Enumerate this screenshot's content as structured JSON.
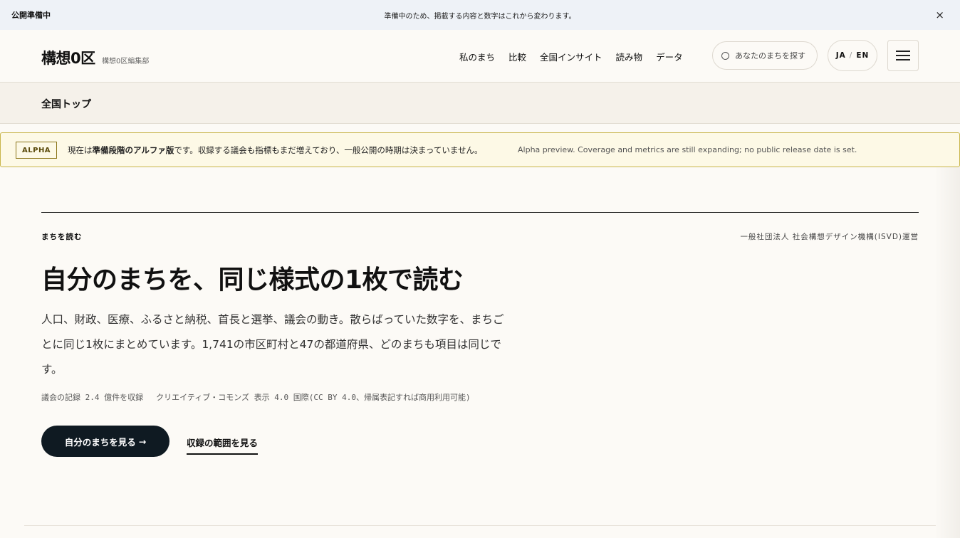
{
  "notice": {
    "label": "公開準備中",
    "message": "準備中のため、掲載する内容と数字はこれから変わります。",
    "close": "×"
  },
  "header": {
    "logo": "構想0区",
    "logo_sub": "構想0区編集部",
    "nav": [
      "私のまち",
      "比較",
      "全国インサイト",
      "読み物",
      "データ"
    ],
    "search_placeholder": "あなたのまちを探す",
    "lang_ja": "JA",
    "lang_sep": "/",
    "lang_en": "EN"
  },
  "breadcrumb": {
    "current": "全国トップ"
  },
  "alpha": {
    "badge": "ALPHA",
    "jp_pre": "現在は",
    "jp_bold": "準備段階のアルファ版",
    "jp_post": "です。収録する議会も指標もまだ増えており、一般公開の時期は決まっていません。",
    "en": "Alpha preview. Coverage and metrics are still expanding; no public release date is set."
  },
  "hero": {
    "eyebrow": "まちを読む",
    "org": "一般社団法人 社会構想デザイン機構(ISVD)運営",
    "title": "自分のまちを、同じ様式の1枚で読む",
    "lead": "人口、財政、医療、ふるさと納税、首長と選挙、議会の動き。散らばっていた数字を、まちごとに同じ1枚にまとめています。1,741の市区町村と47の都道府県、どのまちも項目は同じです。",
    "meta_records": "議会の記録 2.4 億件を収録",
    "meta_license": "クリエイティブ・コモンズ 表示 4.0 国際(CC BY 4.0、帰属表記すれば商用利用可能)",
    "cta_label": "自分のまちを見る",
    "cta_arrow": "→",
    "secondary_label": "収録の範囲を見る"
  }
}
